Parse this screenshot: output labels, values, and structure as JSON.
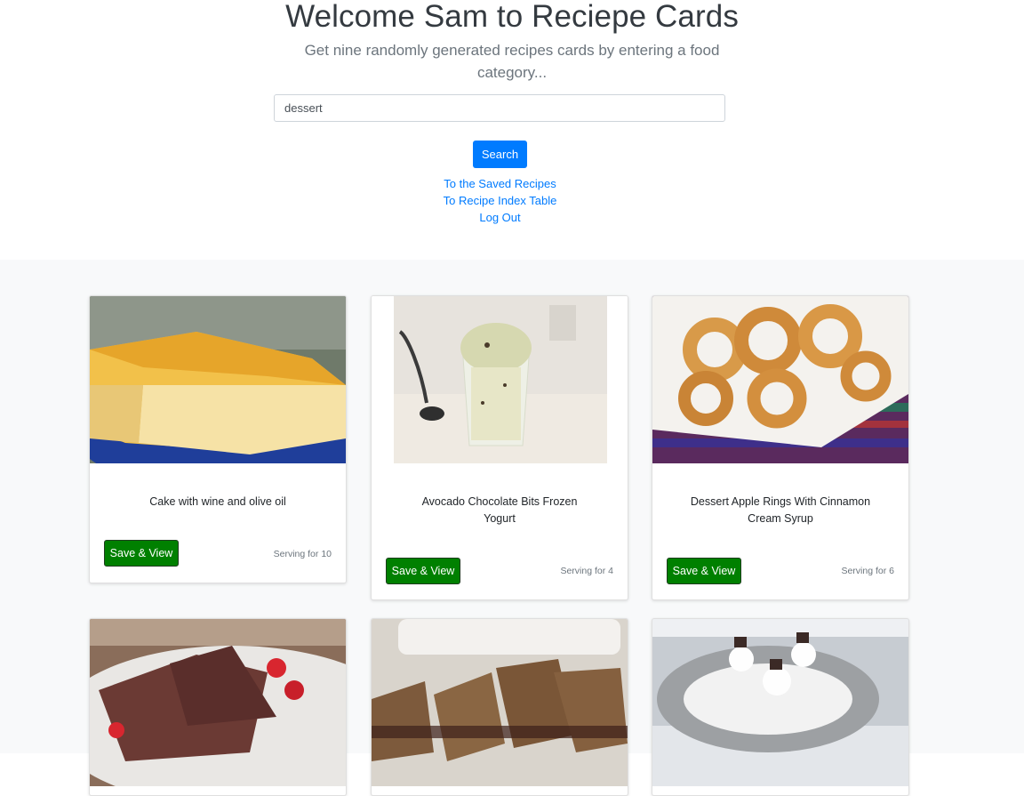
{
  "header": {
    "title": "Welcome Sam to Reciepe Cards",
    "subtitle": "Get nine randomly generated recipes cards by entering a food category..."
  },
  "search": {
    "value": "dessert",
    "button_label": "Search"
  },
  "links": {
    "saved": "To the Saved Recipes",
    "index": "To Recipe Index Table",
    "logout": "Log Out"
  },
  "cards": [
    {
      "title": "Cake with wine and olive oil",
      "button": "Save & View",
      "serving": "Serving for 10"
    },
    {
      "title": "Avocado Chocolate Bits Frozen Yogurt",
      "button": "Save & View",
      "serving": "Serving for 4"
    },
    {
      "title": "Dessert Apple Rings With Cinnamon Cream Syrup",
      "button": "Save & View",
      "serving": "Serving for 6"
    }
  ],
  "colors": {
    "primary": "#007bff",
    "save_button": "#008000",
    "album_bg": "#f8f9fa"
  }
}
